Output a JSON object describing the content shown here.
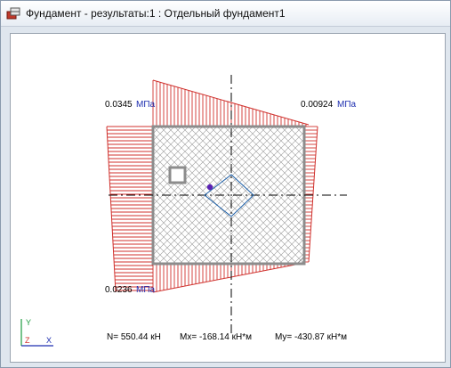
{
  "window": {
    "title": "Фундамент - результаты:1 : Отдельный фундамент1",
    "icon": "foundation-app-icon"
  },
  "drawing": {
    "pressure_labels": {
      "top_left": {
        "value": "0.0345",
        "unit": "МПа"
      },
      "top_right": {
        "value": "0.00924",
        "unit": "МПа"
      },
      "bottom_left": {
        "value": "0.0236",
        "unit": "МПа"
      }
    },
    "forces": {
      "n": "N= 550.44 кН",
      "mx": "Mx= -168.14 кН*м",
      "my": "My= -430.87 кН*м"
    },
    "axes": {
      "y": "Y",
      "z": "Z",
      "x": "X"
    },
    "colors": {
      "hatch": "#d0312d",
      "slab_border": "#8c8c8c",
      "column": "#1c5fa8",
      "point": "#5b21b6",
      "unit_text": "#1e2fb0",
      "axis_icon": "#1d9b3f"
    }
  }
}
